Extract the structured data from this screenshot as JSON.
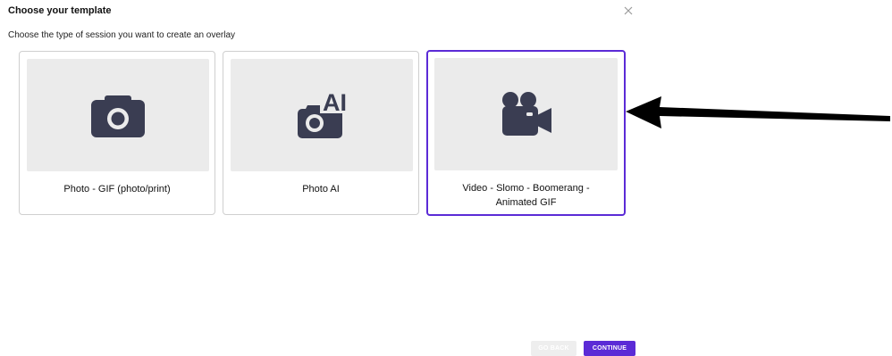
{
  "dialog": {
    "title": "Choose your template",
    "subtitle": "Choose the type of session you want to create an overlay",
    "close_icon": "close-icon"
  },
  "templates": [
    {
      "label": "Photo - GIF (photo/print)",
      "icon": "camera-icon",
      "selected": false
    },
    {
      "label": "Photo AI",
      "icon": "camera-ai-icon",
      "icon_text": "AI",
      "selected": false
    },
    {
      "label": "Video - Slomo - Boomerang - Animated GIF",
      "icon": "video-camera-icon",
      "selected": true
    }
  ],
  "footer": {
    "back_label": "GO BACK",
    "continue_label": "CONTINUE"
  },
  "colors": {
    "accent": "#5b2bd6",
    "icon": "#3a3d52",
    "thumb_bg": "#ebebeb",
    "card_border": "#cfcfcf"
  },
  "annotation": {
    "arrow": "arrow-left-icon",
    "points_to": "template-card-video"
  }
}
